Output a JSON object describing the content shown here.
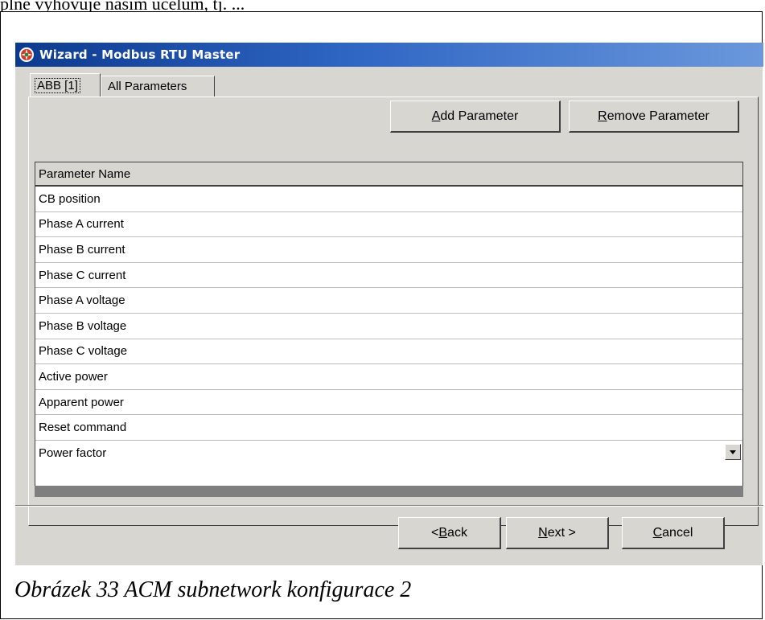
{
  "document": {
    "top_text": "plně vyhovuje našim účelům, tj. ..."
  },
  "window": {
    "title": "Wizard - Modbus RTU Master"
  },
  "tabs": [
    {
      "label": "ABB [1]",
      "selected": true
    },
    {
      "label": "All Parameters",
      "selected": false
    }
  ],
  "toolbar": {
    "add_label_u": "A",
    "add_label_rest": "dd Parameter",
    "remove_label_u": "R",
    "remove_label_rest": "emove Parameter"
  },
  "grid": {
    "header": "Parameter Name",
    "rows": [
      "CB position",
      "Phase A current",
      "Phase B current",
      "Phase C current",
      "Phase A voltage",
      "Phase B voltage",
      "Phase C voltage",
      "Active power",
      "Apparent power",
      "Reset command",
      "Power factor"
    ]
  },
  "footer_buttons": {
    "back_pre": "< ",
    "back_u": "B",
    "back_rest": "ack",
    "next_u": "N",
    "next_rest": "ext >",
    "cancel_u": "C",
    "cancel_rest": "ancel"
  },
  "caption": "Obrázek 33 ACM subnetwork konfigurace 2"
}
